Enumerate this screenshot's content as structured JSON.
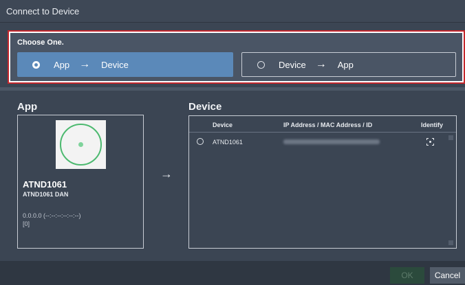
{
  "window": {
    "title": "Connect to Device"
  },
  "choose": {
    "label": "Choose One.",
    "options": [
      {
        "from": "App",
        "to": "Device",
        "arrow": "→",
        "selected": true
      },
      {
        "from": "Device",
        "to": "App",
        "arrow": "→",
        "selected": false
      }
    ]
  },
  "app_panel": {
    "title": "App",
    "device_name": "ATND1061",
    "device_subtitle": "ATND1061 DAN",
    "ip_mac": "0.0.0.0 (--:--:--:--:--:--)",
    "id": "[0]"
  },
  "transfer_arrow": "→",
  "device_panel": {
    "title": "Device",
    "columns": [
      "Device",
      "IP Address / MAC Address / ID",
      "Identify"
    ],
    "rows": [
      {
        "device": "ATND1061",
        "ip_mac_id": "",
        "identify_icon": "identify-icon"
      }
    ]
  },
  "footer": {
    "ok_label": "OK",
    "cancel_label": "Cancel"
  },
  "colors": {
    "selected_option": "#5b89b9",
    "highlight_border": "#c4272d",
    "device_ring": "#4cb96f",
    "background": "#3b4553"
  }
}
